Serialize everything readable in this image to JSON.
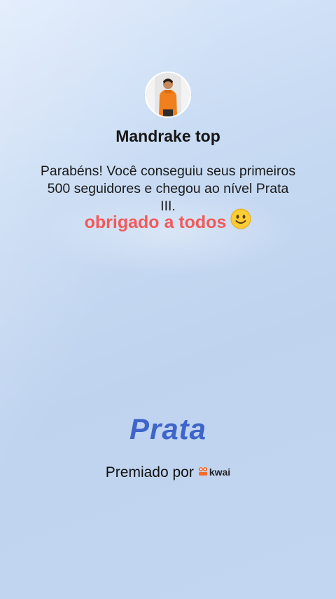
{
  "profile": {
    "name": "Mandrake top"
  },
  "achievement": {
    "message": "Parabéns! Você conseguiu seus primeiros 500 seguidores e chegou ao nível Prata III.",
    "thanks": "obrigado a todos",
    "emoji_icon": "slightly-smiling-face-icon",
    "level": "Prata"
  },
  "footer": {
    "awarded_by": "Premiado por",
    "brand": "kwai",
    "brand_color": "#ff6a2a"
  },
  "colors": {
    "thanks_text": "#f25a5a",
    "level_text": "#3e65c9"
  }
}
